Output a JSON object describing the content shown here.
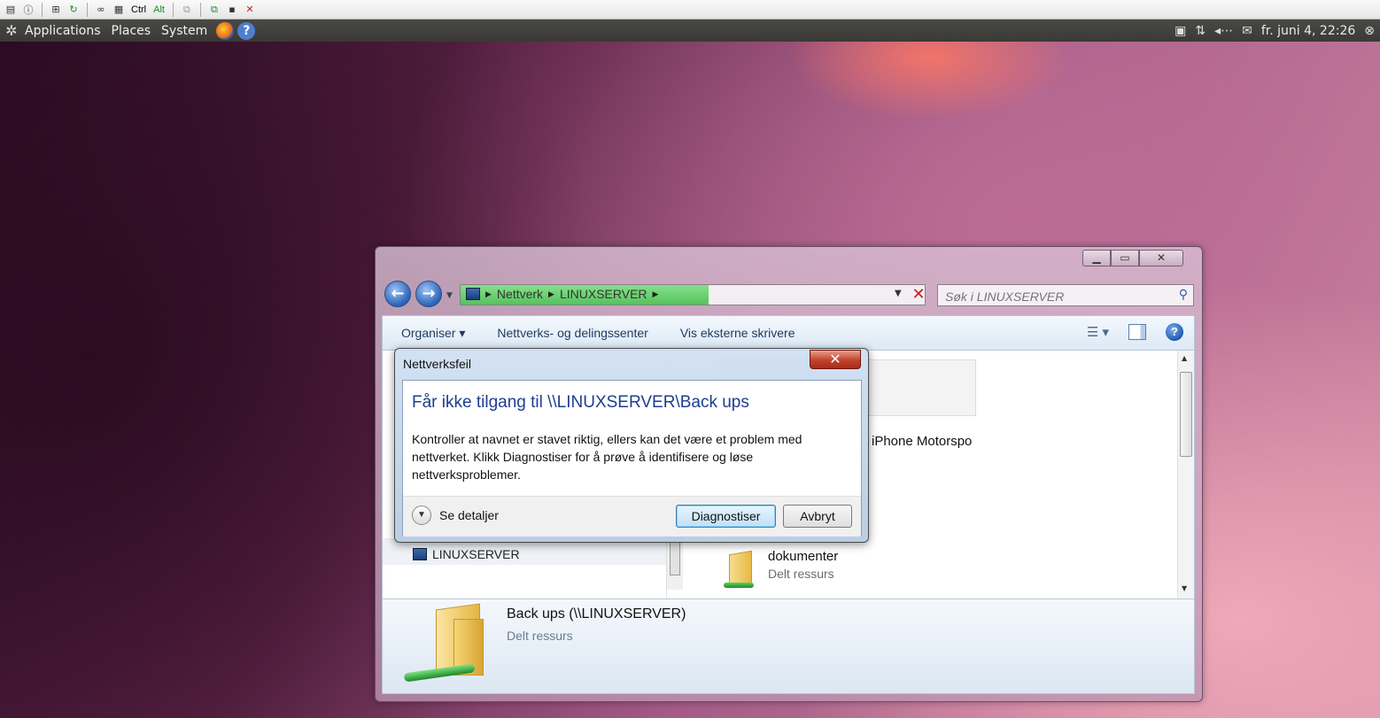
{
  "vnc_toolbar": {
    "ctrl_label": "Ctrl",
    "alt_label": "Alt"
  },
  "panel": {
    "menus": [
      "Applications",
      "Places",
      "System"
    ],
    "clock": "fr. juni  4, 22:26"
  },
  "explorer": {
    "breadcrumb": [
      "Nettverk",
      "LINUXSERVER"
    ],
    "search_placeholder": "Søk i LINUXSERVER",
    "toolbar": {
      "organize": "Organiser ▾",
      "network_center": "Nettverks- og delingssenter",
      "printers": "Vis eksterne skrivere"
    },
    "nav_selected": "LINUXSERVER",
    "partial_share_name": "iPhone Motorspo",
    "items": [
      {
        "name": "dokumenter",
        "type": "Delt ressurs"
      }
    ],
    "details": {
      "name": "Back ups (\\\\LINUXSERVER)",
      "type": "Delt ressurs"
    }
  },
  "dialog": {
    "title": "Nettverksfeil",
    "heading": "Får ikke tilgang til \\\\LINUXSERVER\\Back ups",
    "message": "Kontroller at navnet er stavet riktig, ellers kan det være et problem med nettverket. Klikk Diagnostiser for å prøve å identifisere og løse nettverksproblemer.",
    "details_label": "Se detaljer",
    "diagnose_label": "Diagnostiser",
    "cancel_label": "Avbryt"
  }
}
